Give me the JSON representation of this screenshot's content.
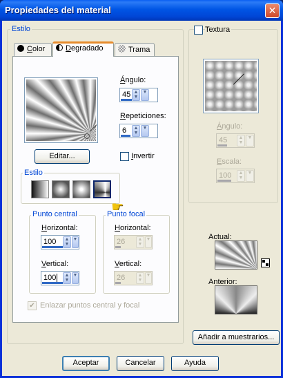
{
  "window": {
    "title": "Propiedades del material",
    "close_glyph": "✕"
  },
  "estilo_group": {
    "label": "Estilo"
  },
  "tabs": [
    {
      "label": "Color",
      "icon": "color-dot-icon",
      "underline_index": 0
    },
    {
      "label": "Degradado",
      "icon": "gradient-half-icon",
      "underline_index": 0,
      "selected": true
    },
    {
      "label": "Trama",
      "icon": "pattern-texture-icon",
      "underline_index": 0
    }
  ],
  "gradient_tab": {
    "angle_label": "Ángulo:",
    "angle_value": "45",
    "repeat_label": "Repeticiones:",
    "repeat_value": "6",
    "edit_button": "Editar...",
    "invert_label": "Invertir",
    "invert_checked": false,
    "style_sub_label": "Estilo",
    "style_icons": [
      "linear-gradient-icon",
      "rectangular-gradient-icon",
      "radial-gradient-icon",
      "sunburst-gradient-icon"
    ],
    "selected_style_index": 3
  },
  "center_point": {
    "label": "Punto central",
    "horizontal_label": "Horizontal:",
    "horizontal_value": "100",
    "vertical_label": "Vertical:",
    "vertical_value": "100"
  },
  "focal_point": {
    "label": "Punto focal",
    "horizontal_label": "Horizontal:",
    "horizontal_value": "26",
    "vertical_label": "Vertical:",
    "vertical_value": "26",
    "enabled": false
  },
  "link_points": {
    "label": "Enlazar puntos central y focal",
    "checked": true,
    "enabled": false
  },
  "texture": {
    "label": "Textura",
    "checked": false,
    "angle_label": "Ángulo:",
    "angle_value": "45",
    "scale_label": "Escala:",
    "scale_value": "100",
    "enabled": false
  },
  "preview": {
    "current_label": "Actual:",
    "previous_label": "Anterior:"
  },
  "buttons": {
    "add_swatch": "Añadir a muestrarios...",
    "ok": "Aceptar",
    "cancel": "Cancelar",
    "help": "Ayuda"
  },
  "colors": {
    "title_bar": "#0055e5",
    "accent": "#e68b2c",
    "group_label": "#0046d5",
    "disabled_text": "#aca899"
  }
}
